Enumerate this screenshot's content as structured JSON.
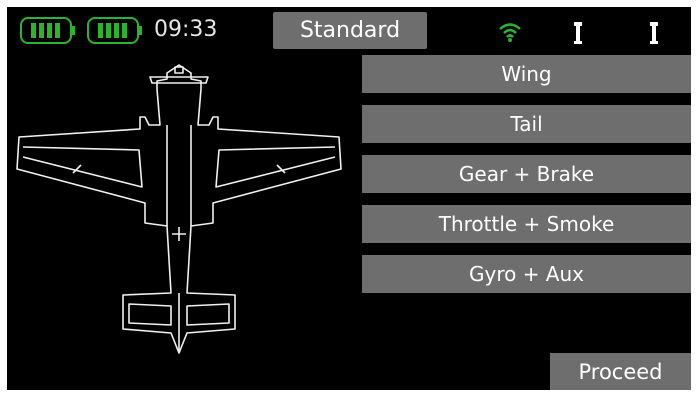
{
  "status_bar": {
    "time": "09:33",
    "mode_label": "Standard",
    "battery_color": "#29b629",
    "signal_color": "#29b629",
    "icons": [
      "battery-icon",
      "battery-icon",
      "wifi-signal-icon",
      "antenna-icon",
      "antenna-icon"
    ]
  },
  "menu": {
    "items": [
      {
        "label": "Wing"
      },
      {
        "label": "Tail"
      },
      {
        "label": "Gear + Brake"
      },
      {
        "label": "Throttle + Smoke"
      },
      {
        "label": "Gyro + Aux"
      }
    ]
  },
  "footer": {
    "proceed_label": "Proceed"
  },
  "colors": {
    "background": "#000000",
    "button": "#6e6e6e",
    "text": "#ffffff"
  }
}
